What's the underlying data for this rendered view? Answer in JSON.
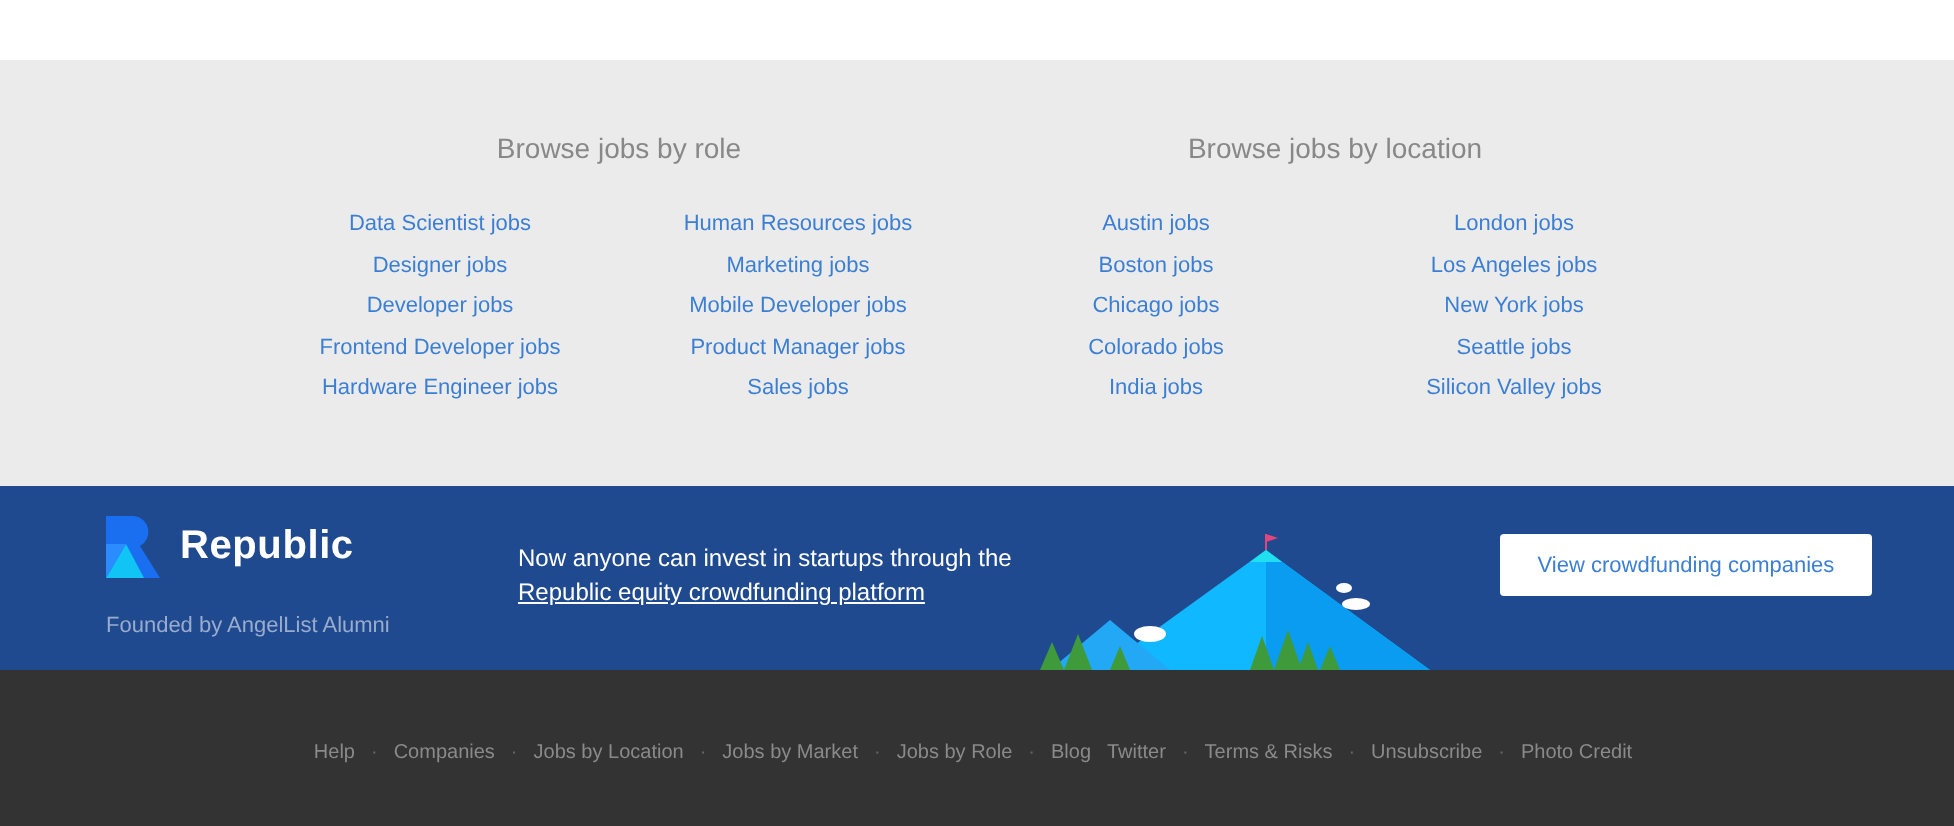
{
  "browse": [
    {
      "title": "Browse jobs by role",
      "columns": [
        [
          "Data Scientist jobs",
          "Designer jobs",
          "Developer jobs",
          "Frontend Developer jobs",
          "Hardware Engineer jobs"
        ],
        [
          "Human Resources jobs",
          "Marketing jobs",
          "Mobile Developer jobs",
          "Product Manager jobs",
          "Sales jobs"
        ]
      ]
    },
    {
      "title": "Browse jobs by location",
      "columns": [
        [
          "Austin jobs",
          "Boston jobs",
          "Chicago jobs",
          "Colorado jobs",
          "India jobs"
        ],
        [
          "London jobs",
          "Los Angeles jobs",
          "New York jobs",
          "Seattle jobs",
          "Silicon Valley jobs"
        ]
      ]
    }
  ],
  "promo": {
    "brand": "Republic",
    "tagline": "Founded by AngelList Alumni",
    "text": "Now anyone can invest in startups through the",
    "link": "Republic equity crowdfunding platform",
    "button": "View crowdfunding companies"
  },
  "footer": {
    "items": [
      {
        "kind": "link",
        "text": "Help"
      },
      {
        "kind": "separator",
        "text": "·"
      },
      {
        "kind": "link",
        "text": "Companies"
      },
      {
        "kind": "separator",
        "text": "·"
      },
      {
        "kind": "link",
        "text": "Jobs by Location"
      },
      {
        "kind": "separator",
        "text": "·"
      },
      {
        "kind": "link",
        "text": "Jobs by Market"
      },
      {
        "kind": "separator",
        "text": "·"
      },
      {
        "kind": "link",
        "text": "Jobs by Role"
      },
      {
        "kind": "separator",
        "text": "·"
      },
      {
        "kind": "link",
        "text": "Blog"
      },
      {
        "kind": "link",
        "text": "Twitter"
      },
      {
        "kind": "separator",
        "text": "·"
      },
      {
        "kind": "link",
        "text": "Terms & Risks"
      },
      {
        "kind": "separator",
        "text": "·"
      },
      {
        "kind": "link",
        "text": "Unsubscribe"
      },
      {
        "kind": "separator",
        "text": "·"
      },
      {
        "kind": "link",
        "text": "Photo Credit"
      }
    ]
  }
}
